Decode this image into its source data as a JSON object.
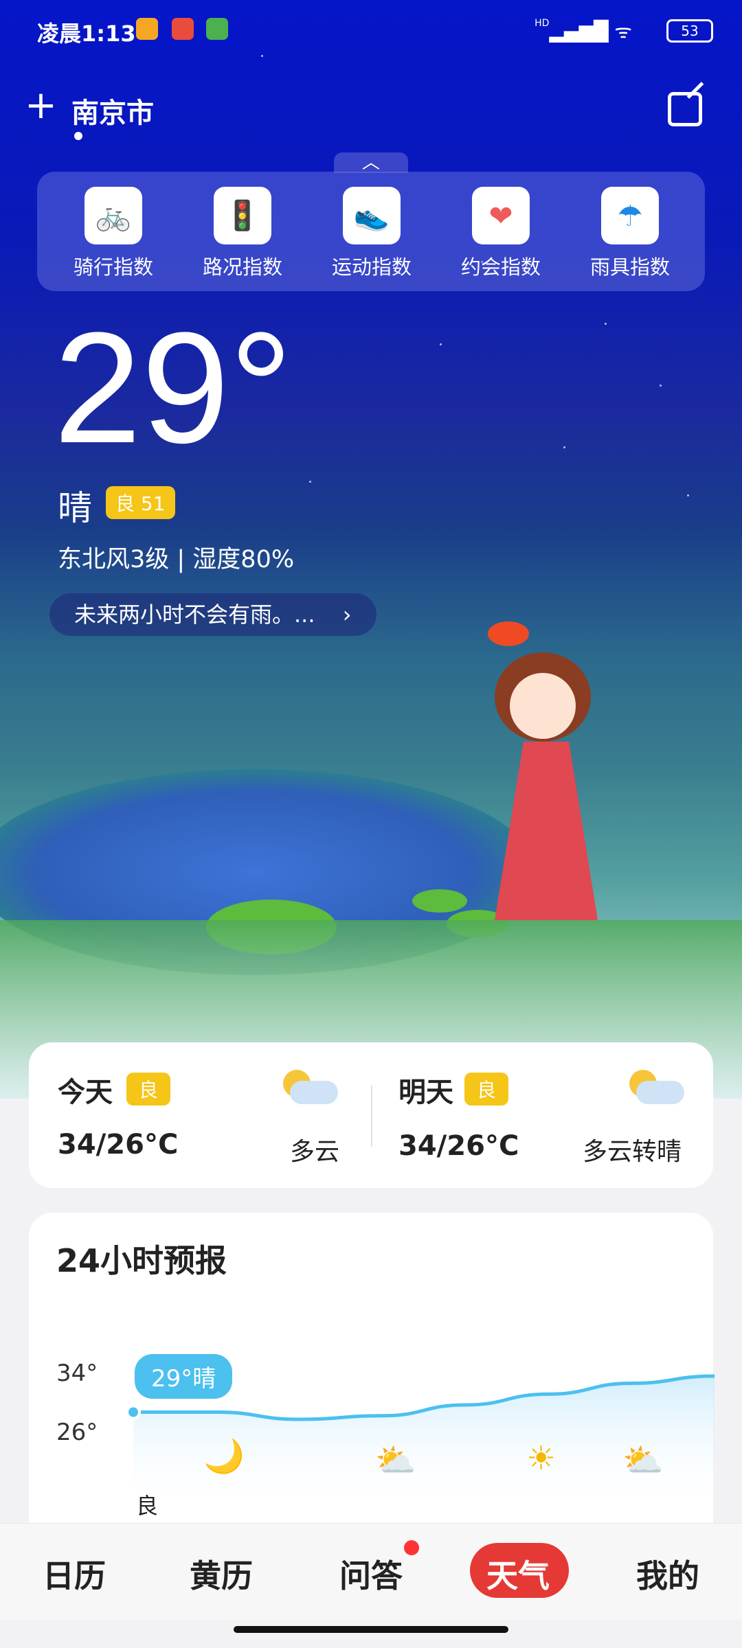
{
  "status": {
    "time": "凌晨1:13",
    "signal": "HD",
    "battery": "53"
  },
  "header": {
    "city": "南京市"
  },
  "indices": [
    "骑行指数",
    "路况指数",
    "运动指数",
    "约会指数",
    "雨具指数"
  ],
  "index_icons": [
    "bike-icon",
    "traffic-light-icon",
    "shoe-icon",
    "heart-icon",
    "umbrella-icon"
  ],
  "current": {
    "temperature": "29°",
    "condition": "晴",
    "aqi": "良 51",
    "wind_humidity": "东北风3级 | 湿度80%",
    "rain_forecast": "未来两小时不会有雨。..."
  },
  "daily": [
    {
      "name": "今天",
      "aqi": "良",
      "range": "34/26°C",
      "desc": "多云"
    },
    {
      "name": "明天",
      "aqi": "良",
      "range": "34/26°C",
      "desc": "多云转晴"
    }
  ],
  "hourly": {
    "title": "24小时预报",
    "y_ticks": [
      "34°",
      "26°"
    ],
    "now": "29°晴",
    "aqi": "良"
  },
  "chart_data": {
    "type": "line",
    "series": [
      {
        "values": [
          29,
          29,
          28,
          28.5,
          30,
          31.5,
          33,
          34
        ]
      }
    ],
    "ylim": [
      26,
      34
    ],
    "yticks": [
      "34°",
      "26°"
    ]
  },
  "nav": [
    "日历",
    "黄历",
    "问答",
    "天气",
    "我的"
  ],
  "colors": {
    "accent": "#e53935",
    "badge": "#f5c518",
    "line": "#4cc0ef"
  }
}
